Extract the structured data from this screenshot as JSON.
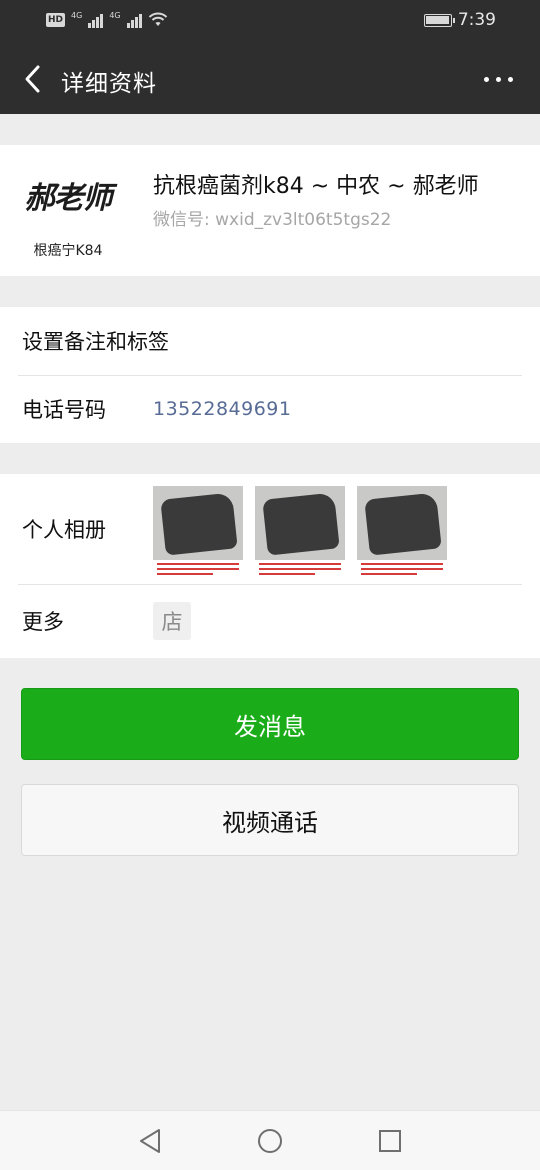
{
  "status_bar": {
    "hd": "HD",
    "net1": "4G",
    "net2": "4G",
    "time": "7:39"
  },
  "header": {
    "title": "详细资料",
    "back_icon": "chevron-left-icon",
    "more_icon": "more-horizontal-icon"
  },
  "profile": {
    "avatar_logo": "郝老师",
    "avatar_subtitle": "根癌宁K84",
    "name": "抗根癌菌剂k84 ~ 中农 ~ 郝老师",
    "wechat_id": "微信号: wxid_zv3lt06t5tgs22"
  },
  "rows": {
    "remark": "设置备注和标签",
    "phone_label": "电话号码",
    "phone_value": "13522849691",
    "album_label": "个人相册",
    "more_label": "更多",
    "store_icon": "店"
  },
  "buttons": {
    "message": "发消息",
    "video_call": "视频通话"
  },
  "colors": {
    "header_bg": "#2e2e2e",
    "primary_green": "#1aad19",
    "link_blue": "#576b95",
    "page_bg": "#ededed"
  },
  "nav": {
    "back_icon": "triangle-back-icon",
    "home_icon": "circle-home-icon",
    "recents_icon": "square-recents-icon"
  }
}
